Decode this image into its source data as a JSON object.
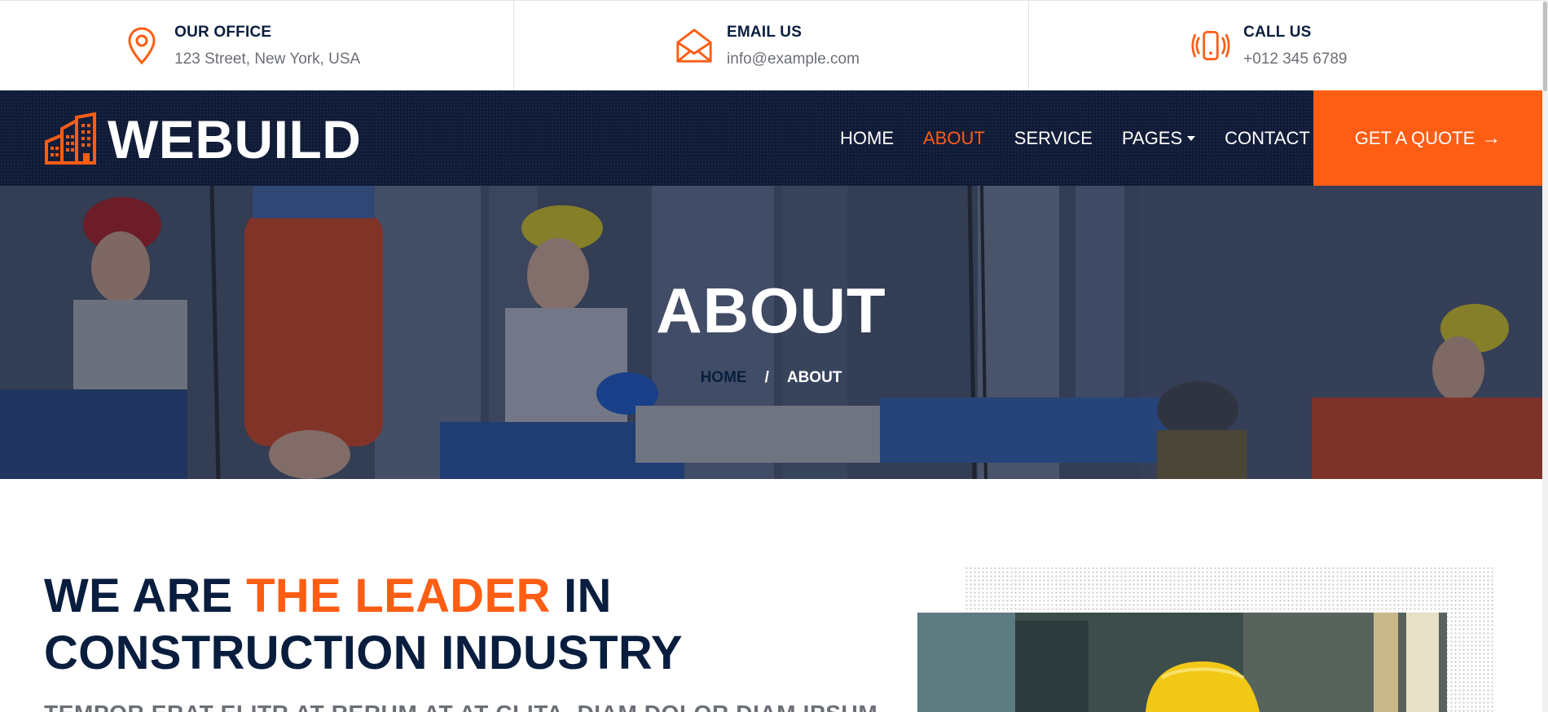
{
  "topbar": {
    "office": {
      "icon": "map-pin-icon",
      "title": "OUR OFFICE",
      "value": "123 Street, New York, USA"
    },
    "email": {
      "icon": "envelope-icon",
      "title": "EMAIL US",
      "value": "info@example.com"
    },
    "call": {
      "icon": "phone-ring-icon",
      "title": "CALL US",
      "value": "+012 345 6789"
    }
  },
  "brand": {
    "name": "WEBUILD",
    "icon": "building-icon"
  },
  "nav": {
    "items": [
      {
        "label": "HOME",
        "active": false
      },
      {
        "label": "ABOUT",
        "active": true
      },
      {
        "label": "SERVICE",
        "active": false
      },
      {
        "label": "PAGES",
        "active": false,
        "dropdown": true
      },
      {
        "label": "CONTACT",
        "active": false
      }
    ],
    "cta": "GET A QUOTE",
    "cta_arrow": "→"
  },
  "hero": {
    "title": "ABOUT",
    "breadcrumb": {
      "home": "HOME",
      "separator": "/",
      "current": "ABOUT"
    }
  },
  "about": {
    "heading_pre": "WE ARE ",
    "heading_highlight": "THE LEADER",
    "heading_post": " IN",
    "heading_line2": "CONSTRUCTION INDUSTRY",
    "subtitle": "TEMPOR ERAT ELITR AT RERUM AT AT CLITA. DIAM DOLOR DIAM IPSUM"
  },
  "colors": {
    "accent": "#fe5d14",
    "navy": "#101b37",
    "dark_text": "#091e3e",
    "muted_text": "#6b6f76"
  }
}
